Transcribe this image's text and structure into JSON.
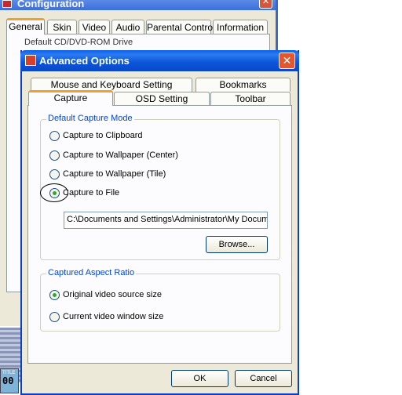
{
  "config_window": {
    "title": "Configuration",
    "close_glyph": "✕",
    "tabs": [
      {
        "label": "General",
        "selected": true
      },
      {
        "label": "Skin",
        "selected": false
      },
      {
        "label": "Video",
        "selected": false
      },
      {
        "label": "Audio",
        "selected": false
      },
      {
        "label": "Parental Control",
        "selected": false
      },
      {
        "label": "Information",
        "selected": false
      }
    ],
    "group_label": "Default CD/DVD-ROM Drive",
    "strip": {
      "small_text": "TITLE",
      "number": "00"
    }
  },
  "dialog": {
    "title": "Advanced Options",
    "close_glyph": "✕",
    "tabs_row1": [
      {
        "label": "Mouse and Keyboard Setting"
      },
      {
        "label": "Bookmarks"
      }
    ],
    "tabs_row2": [
      {
        "label": "Capture",
        "selected": true
      },
      {
        "label": "OSD Setting",
        "selected": false
      },
      {
        "label": "Toolbar",
        "selected": false
      }
    ],
    "capture_mode": {
      "legend": "Default Capture Mode",
      "options": [
        {
          "label": "Capture to Clipboard",
          "checked": false
        },
        {
          "label": "Capture to Wallpaper (Center)",
          "checked": false
        },
        {
          "label": "Capture to Wallpaper (Tile)",
          "checked": false
        },
        {
          "label": "Capture to File",
          "checked": true
        }
      ],
      "path_value": "C:\\Documents and Settings\\Administrator\\My Documents",
      "browse_label": "Browse..."
    },
    "aspect_ratio": {
      "legend": "Captured Aspect Ratio",
      "options": [
        {
          "label": "Original video source size",
          "checked": true
        },
        {
          "label": "Current video window size",
          "checked": false
        }
      ]
    },
    "ok_label": "OK",
    "cancel_label": "Cancel"
  },
  "colors": {
    "title_bar": "#0b54d8",
    "tab_highlight": "#f0a030",
    "group_legend": "#0046d5",
    "radio_checked": "#2bab2b"
  }
}
